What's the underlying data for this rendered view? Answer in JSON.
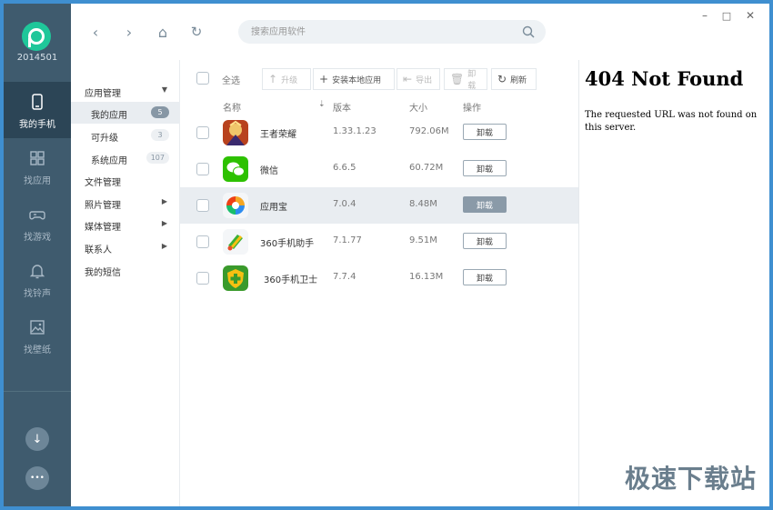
{
  "app": {
    "user_id": "2014501"
  },
  "rail": {
    "items": [
      {
        "label": "我的手机",
        "icon": "phone-icon",
        "active": true
      },
      {
        "label": "找应用",
        "icon": "apps-grid-icon",
        "active": false
      },
      {
        "label": "找游戏",
        "icon": "gamepad-icon",
        "active": false
      },
      {
        "label": "找铃声",
        "icon": "bell-icon",
        "active": false
      },
      {
        "label": "找壁纸",
        "icon": "image-icon",
        "active": false
      }
    ],
    "bottom": {
      "download": "↓",
      "more": "•••"
    }
  },
  "topbar": {
    "back": "‹",
    "forward": "›",
    "home": "⌂",
    "refresh": "↻",
    "search_placeholder": "搜索应用软件",
    "win_min": "–",
    "win_max": "□",
    "win_close": "✕"
  },
  "subnav": {
    "app_manage": "应用管理",
    "my_apps": "我的应用",
    "my_apps_count": "5",
    "upgradable": "可升级",
    "upgradable_count": "3",
    "system_apps": "系统应用",
    "system_apps_count": "107",
    "file_manage": "文件管理",
    "photo_manage": "照片管理",
    "media_manage": "媒体管理",
    "contacts": "联系人",
    "sms": "我的短信"
  },
  "toolbar": {
    "select_all": "全选",
    "upgrade": "升级",
    "install_local": "安装本地应用",
    "export": "导出",
    "uninstall": "卸载",
    "refresh": "刷新"
  },
  "columns": {
    "name": "名称",
    "version": "版本",
    "size": "大小",
    "action": "操作"
  },
  "rows": [
    {
      "name": "王者荣耀",
      "version": "1.33.1.23",
      "size": "792.06M",
      "action": "卸载"
    },
    {
      "name": "微信",
      "version": "6.6.5",
      "size": "60.72M",
      "action": "卸载"
    },
    {
      "name": "应用宝",
      "version": "7.0.4",
      "size": "8.48M",
      "action": "卸载"
    },
    {
      "name": "360手机助手",
      "version": "7.1.77",
      "size": "9.51M",
      "action": "卸载"
    },
    {
      "name": "360手机卫士",
      "version": "7.7.4",
      "size": "16.13M",
      "action": "卸载"
    }
  ],
  "error_pane": {
    "title": "404 Not Found",
    "message": "The requested URL was not found on this server."
  },
  "watermark": "极速下载站",
  "colors": {
    "rail": "#3f5b6e",
    "brand": "#1fc79a",
    "selected_row": "#e9edf1"
  }
}
